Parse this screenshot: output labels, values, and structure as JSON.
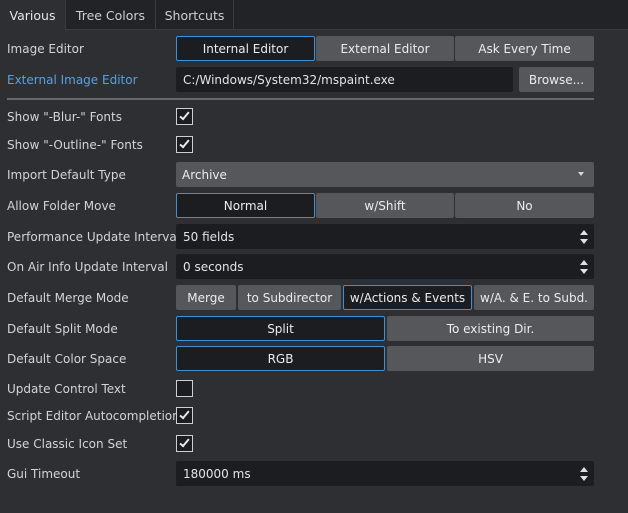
{
  "tabs": [
    {
      "label": "Various"
    },
    {
      "label": "Tree Colors"
    },
    {
      "label": "Shortcuts"
    }
  ],
  "image_editor": {
    "label": "Image Editor",
    "options": [
      "Internal Editor",
      "External Editor",
      "Ask Every Time"
    ],
    "selected": "Internal Editor"
  },
  "external_image_editor": {
    "label": "External Image Editor",
    "value": "C:/Windows/System32/mspaint.exe",
    "browse_label": "Browse..."
  },
  "blur_fonts": {
    "label": "Show \"-Blur-\" Fonts",
    "checked": true
  },
  "outline_fonts": {
    "label": "Show \"-Outline-\" Fonts",
    "checked": true
  },
  "import_default_type": {
    "label": "Import Default Type",
    "value": "Archive"
  },
  "allow_folder_move": {
    "label": "Allow Folder Move",
    "options": [
      "Normal",
      "w/Shift",
      "No"
    ],
    "selected": "Normal"
  },
  "performance_update_interval": {
    "label": "Performance Update Interval",
    "value": "50 fields"
  },
  "on_air_info_update_interval": {
    "label": "On Air Info Update Interval",
    "value": "0 seconds"
  },
  "default_merge_mode": {
    "label": "Default Merge Mode",
    "options": [
      "Merge",
      "to Subdirector",
      "w/Actions & Events",
      "w/A. & E. to Subd."
    ],
    "selected": "w/Actions & Events"
  },
  "default_split_mode": {
    "label": "Default Split Mode",
    "options": [
      "Split",
      "To existing Dir."
    ],
    "selected": "Split"
  },
  "default_color_space": {
    "label": "Default Color Space",
    "options": [
      "RGB",
      "HSV"
    ],
    "selected": "RGB"
  },
  "update_control_text": {
    "label": "Update Control Text",
    "checked": false
  },
  "script_editor_autocompletion": {
    "label": "Script Editor Autocompletion",
    "checked": true
  },
  "use_classic_icon_set": {
    "label": "Use Classic Icon Set",
    "checked": true
  },
  "gui_timeout": {
    "label": "Gui Timeout",
    "value": "180000 ms"
  },
  "colors": {
    "background": "#2e2f32",
    "field_bg": "#1c1d20",
    "button_bg": "#55575b",
    "selected_border": "#3d8fd6",
    "link_label": "#5aa0e0"
  }
}
